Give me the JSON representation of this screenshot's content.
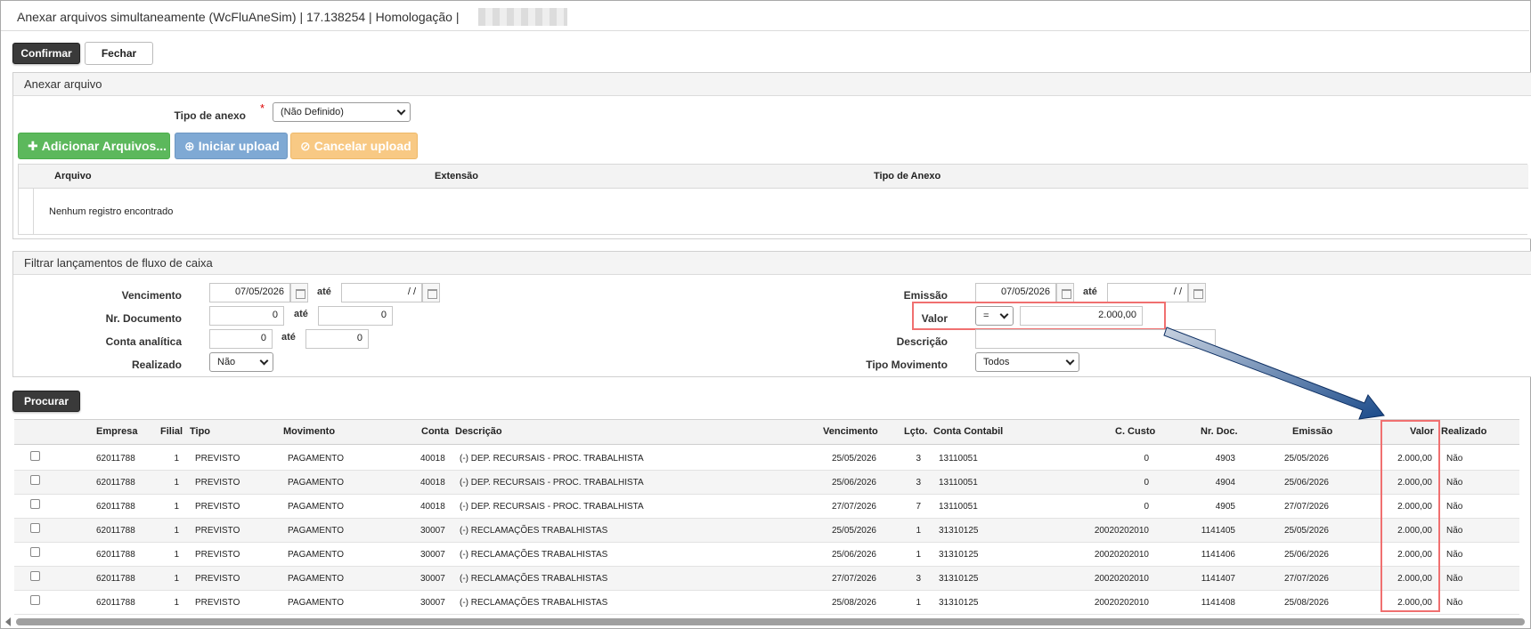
{
  "window": {
    "title": "Anexar arquivos simultaneamente (WcFluAneSim) | 17.138254 | Homologação |"
  },
  "toolbar": {
    "confirm_label": "Confirmar",
    "close_label": "Fechar"
  },
  "attach": {
    "section_title": "Anexar arquivo",
    "type_label": "Tipo de anexo",
    "required_mark": "*",
    "type_value": "(Não Definido)",
    "add_label": "Adicionar Arquivos...",
    "start_label": "Iniciar upload",
    "cancel_label": "Cancelar upload",
    "columns": [
      "Arquivo",
      "Extensão",
      "Tipo de Anexo"
    ],
    "empty_message": "Nenhum registro encontrado"
  },
  "filter": {
    "section_title": "Filtrar lançamentos de fluxo de caixa",
    "vencimento_label": "Vencimento",
    "vencimento_from": "07/05/2026",
    "vencimento_to": "/ /",
    "ate_label": "até",
    "nr_documento_label": "Nr. Documento",
    "nr_documento_from": "0",
    "nr_documento_to": "0",
    "conta_label": "Conta analítica",
    "conta_from": "0",
    "conta_to": "0",
    "realizado_label": "Realizado",
    "realizado_value": "Não",
    "emissao_label": "Emissão",
    "emissao_from": "07/05/2026",
    "emissao_to": "/ /",
    "valor_label": "Valor",
    "valor_operator": "=",
    "valor_value": "2.000,00",
    "descricao_label": "Descrição",
    "descricao_value": "",
    "tipo_mov_label": "Tipo Movimento",
    "tipo_mov_value": "Todos",
    "search_label": "Procurar"
  },
  "grid": {
    "columns": {
      "empresa": "Empresa",
      "filial": "Filial",
      "tipo": "Tipo",
      "movimento": "Movimento",
      "conta": "Conta",
      "descricao": "Descrição",
      "vencimento": "Vencimento",
      "lcto": "Lçto.",
      "conta_contabil": "Conta Contabil",
      "c_custo": "C. Custo",
      "nr_doc": "Nr. Doc.",
      "emissao": "Emissão",
      "valor": "Valor",
      "realizado": "Realizado"
    },
    "rows": [
      {
        "empresa": "62011788",
        "filial": "1",
        "tipo": "PREVISTO",
        "movimento": "PAGAMENTO",
        "conta": "40018",
        "descricao": "(-) DEP. RECURSAIS - PROC. TRABALHISTA",
        "vencimento": "25/05/2026",
        "lcto": "3",
        "conta_contabil": "13110051",
        "c_custo": "0",
        "nr_doc": "4903",
        "emissao": "25/05/2026",
        "valor": "2.000,00",
        "realizado": "Não"
      },
      {
        "empresa": "62011788",
        "filial": "1",
        "tipo": "PREVISTO",
        "movimento": "PAGAMENTO",
        "conta": "40018",
        "descricao": "(-) DEP. RECURSAIS - PROC. TRABALHISTA",
        "vencimento": "25/06/2026",
        "lcto": "3",
        "conta_contabil": "13110051",
        "c_custo": "0",
        "nr_doc": "4904",
        "emissao": "25/06/2026",
        "valor": "2.000,00",
        "realizado": "Não"
      },
      {
        "empresa": "62011788",
        "filial": "1",
        "tipo": "PREVISTO",
        "movimento": "PAGAMENTO",
        "conta": "40018",
        "descricao": "(-) DEP. RECURSAIS - PROC. TRABALHISTA",
        "vencimento": "27/07/2026",
        "lcto": "7",
        "conta_contabil": "13110051",
        "c_custo": "0",
        "nr_doc": "4905",
        "emissao": "27/07/2026",
        "valor": "2.000,00",
        "realizado": "Não"
      },
      {
        "empresa": "62011788",
        "filial": "1",
        "tipo": "PREVISTO",
        "movimento": "PAGAMENTO",
        "conta": "30007",
        "descricao": "(-) RECLAMAÇÕES TRABALHISTAS",
        "vencimento": "25/05/2026",
        "lcto": "1",
        "conta_contabil": "31310125",
        "c_custo": "20020202010",
        "nr_doc": "1141405",
        "emissao": "25/05/2026",
        "valor": "2.000,00",
        "realizado": "Não"
      },
      {
        "empresa": "62011788",
        "filial": "1",
        "tipo": "PREVISTO",
        "movimento": "PAGAMENTO",
        "conta": "30007",
        "descricao": "(-) RECLAMAÇÕES TRABALHISTAS",
        "vencimento": "25/06/2026",
        "lcto": "1",
        "conta_contabil": "31310125",
        "c_custo": "20020202010",
        "nr_doc": "1141406",
        "emissao": "25/06/2026",
        "valor": "2.000,00",
        "realizado": "Não"
      },
      {
        "empresa": "62011788",
        "filial": "1",
        "tipo": "PREVISTO",
        "movimento": "PAGAMENTO",
        "conta": "30007",
        "descricao": "(-) RECLAMAÇÕES TRABALHISTAS",
        "vencimento": "27/07/2026",
        "lcto": "3",
        "conta_contabil": "31310125",
        "c_custo": "20020202010",
        "nr_doc": "1141407",
        "emissao": "27/07/2026",
        "valor": "2.000,00",
        "realizado": "Não"
      },
      {
        "empresa": "62011788",
        "filial": "1",
        "tipo": "PREVISTO",
        "movimento": "PAGAMENTO",
        "conta": "30007",
        "descricao": "(-) RECLAMAÇÕES TRABALHISTAS",
        "vencimento": "25/08/2026",
        "lcto": "1",
        "conta_contabil": "31310125",
        "c_custo": "20020202010",
        "nr_doc": "1141408",
        "emissao": "25/08/2026",
        "valor": "2.000,00",
        "realizado": "Não"
      }
    ]
  },
  "colors": {
    "success": "#5cb85c",
    "primary": "#7fa9d4",
    "warning": "#f8c984",
    "highlight": "#f07070",
    "arrow": "#1a4a8a"
  }
}
